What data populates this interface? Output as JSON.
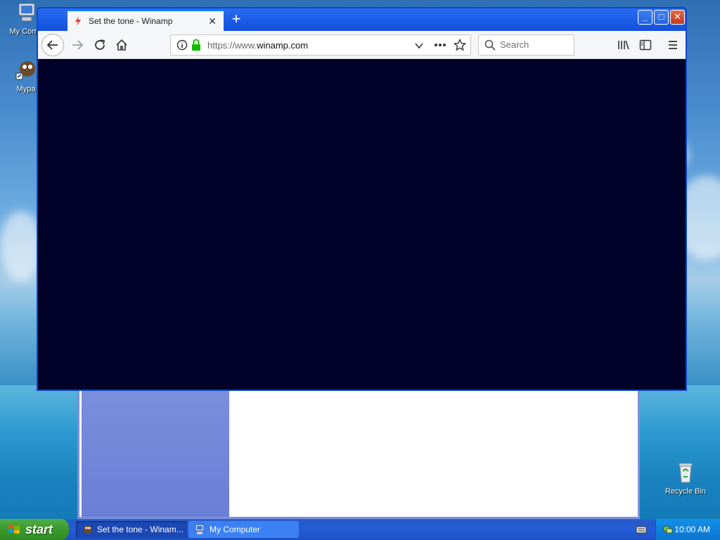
{
  "desktop": {
    "icons": [
      {
        "label": "My Comp"
      },
      {
        "label": "Mypa"
      },
      {
        "label": "Recycle Bin"
      }
    ]
  },
  "browser": {
    "tab": {
      "title": "Set the tone - Winamp"
    },
    "url": {
      "scheme": "https://www.",
      "host": "winamp.com"
    },
    "search": {
      "placeholder": "Search"
    },
    "content_color": "#000028"
  },
  "taskbar": {
    "start_label": "start",
    "items": [
      {
        "label": "Set the tone - Winam...",
        "active": true
      },
      {
        "label": "My Computer",
        "active": false
      }
    ],
    "clock": "10:00 AM"
  },
  "colors": {
    "xp_blue": "#245ddb",
    "start_green": "#3a9a2d",
    "tray_blue": "#0f82dc",
    "firefox_accent": "#0a84ff"
  }
}
